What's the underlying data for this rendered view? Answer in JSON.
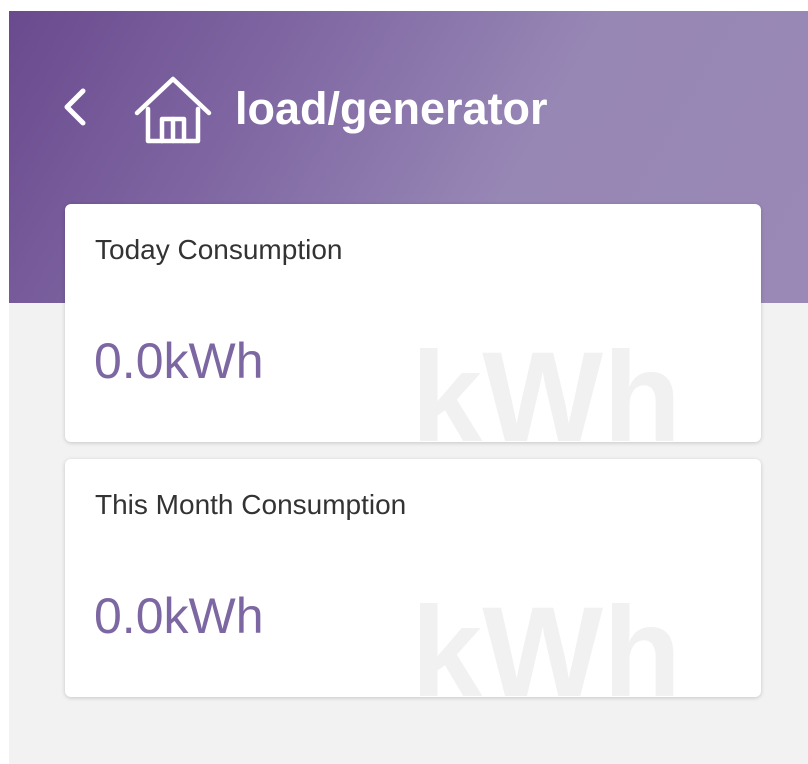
{
  "header": {
    "title": "load/generator",
    "back_icon": "chevron-left-icon",
    "home_icon": "home-icon"
  },
  "cards": [
    {
      "label": "Today Consumption",
      "value": "0.0kWh",
      "watermark": "kWh"
    },
    {
      "label": "This Month Consumption",
      "value": "0.0kWh",
      "watermark": "kWh"
    }
  ],
  "colors": {
    "header_gradient_start": "#6a4a8e",
    "header_gradient_end": "#9a88b6",
    "value_text": "#7c67a3",
    "label_text": "#333333",
    "page_background": "#f2f2f2",
    "card_background": "#ffffff"
  }
}
